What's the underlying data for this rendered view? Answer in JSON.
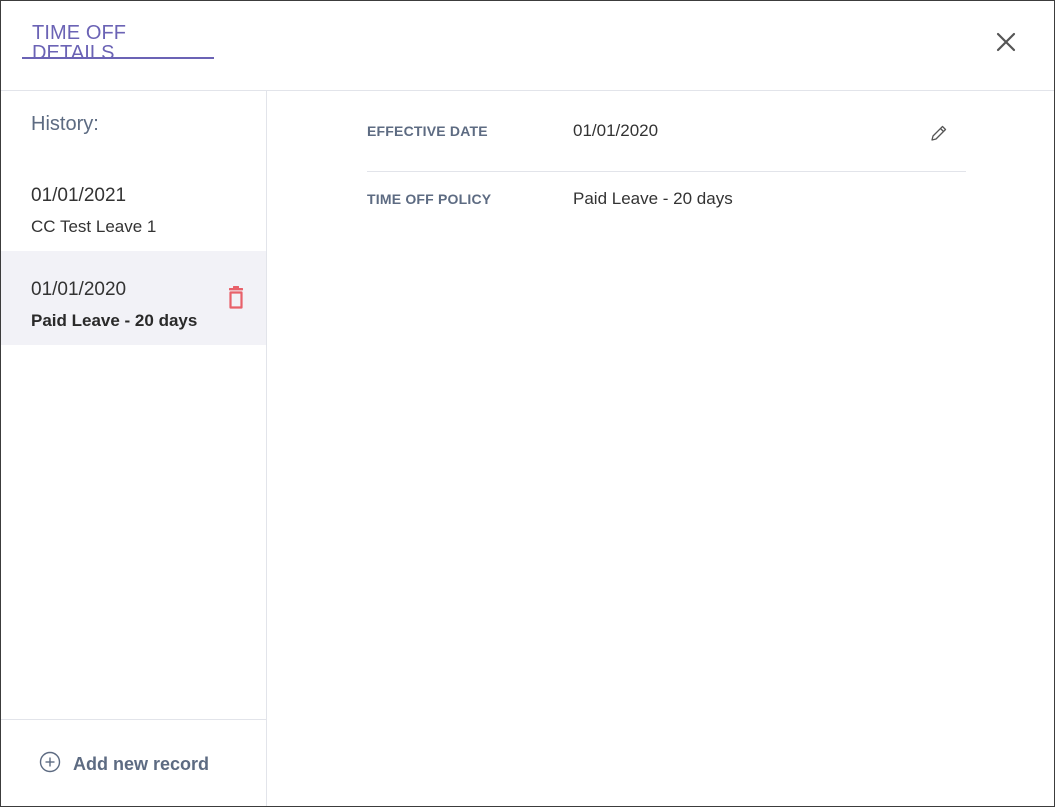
{
  "header": {
    "title": "TIME OFF DETAILS",
    "close_icon": "close-icon"
  },
  "sidebar": {
    "history_label": "History:",
    "items": [
      {
        "date": "01/01/2021",
        "name": "CC Test Leave 1",
        "selected": false
      },
      {
        "date": "01/01/2020",
        "name": "Paid Leave - 20 days",
        "selected": true,
        "action_icon": "trash-icon"
      }
    ],
    "add_record_label": "Add new record",
    "add_record_icon": "plus-circle-icon"
  },
  "details": {
    "effective_date_label": "EFFECTIVE DATE",
    "effective_date_value": "01/01/2020",
    "edit_icon": "pencil-icon",
    "policy_label": "TIME OFF POLICY",
    "policy_value": "Paid Leave - 20 days"
  },
  "colors": {
    "accent": "#6b63b5",
    "label": "#5d6b82",
    "danger": "#e8616a",
    "selected_bg": "#f2f2f7"
  }
}
